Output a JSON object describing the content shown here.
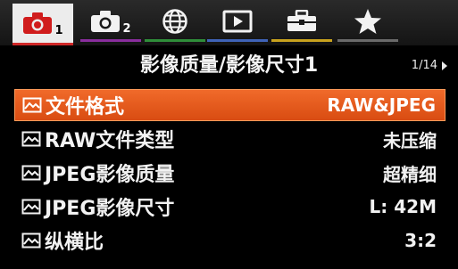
{
  "tabs": [
    {
      "icon": "camera-icon",
      "num": "1",
      "active": true
    },
    {
      "icon": "camera-icon",
      "num": "2",
      "active": false
    },
    {
      "icon": "globe-icon",
      "num": "",
      "active": false
    },
    {
      "icon": "playback-icon",
      "num": "",
      "active": false
    },
    {
      "icon": "toolbox-icon",
      "num": "",
      "active": false
    },
    {
      "icon": "star-icon",
      "num": "",
      "active": false
    }
  ],
  "header": {
    "title": "影像质量/影像尺寸1",
    "page_indicator": "1/14"
  },
  "menu": {
    "items": [
      {
        "label": "文件格式",
        "value": "RAW&JPEG",
        "selected": true
      },
      {
        "label": "RAW文件类型",
        "value": "未压缩",
        "selected": false
      },
      {
        "label": "JPEG影像质量",
        "value": "超精细",
        "selected": false
      },
      {
        "label": "JPEG影像尺寸",
        "value": "L: 42M",
        "selected": false
      },
      {
        "label": "纵横比",
        "value": "3:2",
        "selected": false
      }
    ]
  },
  "colors": {
    "selection": "#e85a1c",
    "tab_active_underline": "#d02828"
  }
}
